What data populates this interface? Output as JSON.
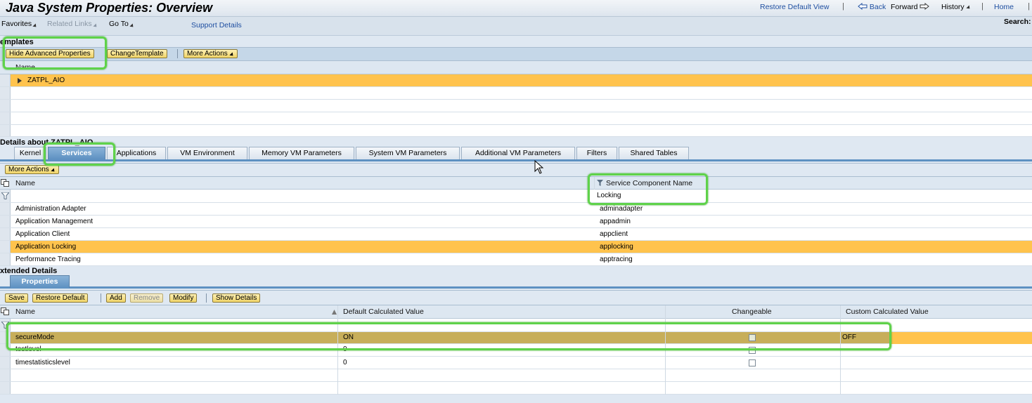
{
  "header": {
    "title": "Java System Properties: Overview",
    "links": {
      "restore_default_view": "Restore Default View",
      "back": "Back",
      "forward": "Forward",
      "history": "History",
      "home": "Home"
    },
    "separator": "|"
  },
  "menu": {
    "favorites": "Favorites",
    "related_links": "Related Links",
    "go_to": "Go To",
    "support_details": "Support Details",
    "search_label": "Search:"
  },
  "templates": {
    "title": "emplates",
    "buttons": {
      "hide_advanced": "Hide Advanced Properties",
      "change_template": "ChangeTemplate",
      "more_actions": "More Actions"
    },
    "column_name": "Name",
    "rows": [
      {
        "name": "ZATPL_AIO"
      }
    ]
  },
  "details": {
    "title": "Details about ZATPL_AIO",
    "tabs": [
      "Kernel",
      "Services",
      "Applications",
      "VM Environment",
      "Memory VM Parameters",
      "System VM Parameters",
      "Additional VM Parameters",
      "Filters",
      "Shared Tables"
    ],
    "active_tab": "Services",
    "more_actions": "More Actions",
    "columns": {
      "name": "Name",
      "service_component": "Service Component Name"
    },
    "filter_value": "Locking",
    "rows": [
      {
        "name": "Administration Adapter",
        "component": "adminadapter"
      },
      {
        "name": "Application Management",
        "component": "appadmin"
      },
      {
        "name": "Application Client",
        "component": "appclient"
      },
      {
        "name": "Application Locking",
        "component": "applocking"
      },
      {
        "name": "Performance Tracing",
        "component": "apptracing"
      }
    ]
  },
  "extended": {
    "title": "xtended Details",
    "tab": "Properties",
    "buttons": {
      "save": "Save",
      "restore_default": "Restore Default",
      "add": "Add",
      "remove": "Remove",
      "modify": "Modify",
      "show_details": "Show Details"
    },
    "columns": {
      "name": "Name",
      "default_value": "Default Calculated Value",
      "changeable": "Changeable",
      "custom_value": "Custom Calculated Value"
    },
    "rows": [
      {
        "name": "secureMode",
        "default": "ON",
        "custom": "OFF"
      },
      {
        "name": "testlevel",
        "default": "0",
        "custom": ""
      },
      {
        "name": "timestatisticslevel",
        "default": "0",
        "custom": ""
      }
    ]
  },
  "colors": {
    "highlight_ring": "#5fd24a",
    "selected_row": "#ffc34d",
    "active_tab": "#5e91c2",
    "button_bg": "#f0d468"
  }
}
